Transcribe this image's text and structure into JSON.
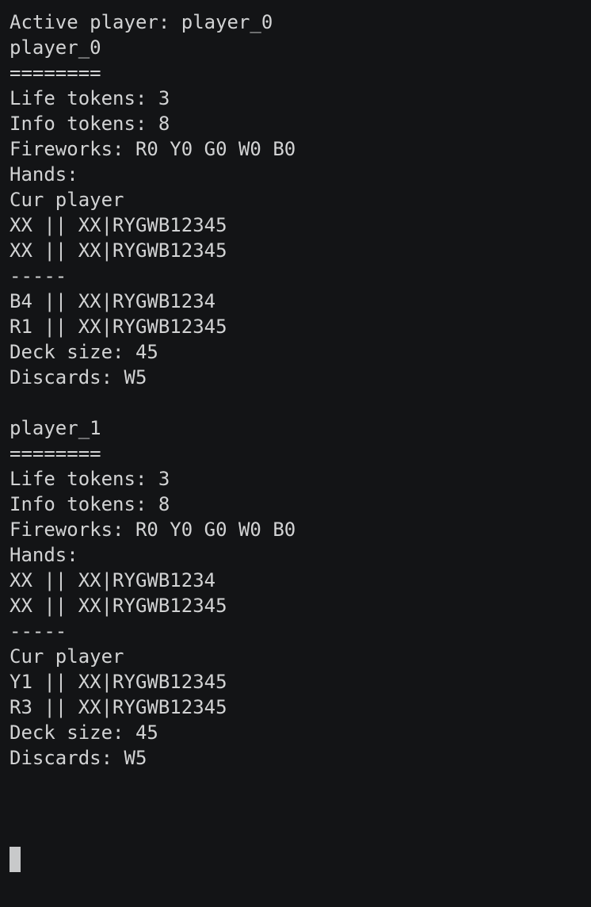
{
  "terminal": {
    "lines": [
      "Active player: player_0",
      "player_0",
      "========",
      "Life tokens: 3",
      "Info tokens: 8",
      "Fireworks: R0 Y0 G0 W0 B0",
      "Hands:",
      "Cur player",
      "XX || XX|RYGWB12345",
      "XX || XX|RYGWB12345",
      "-----",
      "B4 || XX|RYGWB1234",
      "R1 || XX|RYGWB12345",
      "Deck size: 45",
      "Discards: W5",
      "",
      "player_1",
      "========",
      "Life tokens: 3",
      "Info tokens: 8",
      "Fireworks: R0 Y0 G0 W0 B0",
      "Hands:",
      "XX || XX|RYGWB1234",
      "XX || XX|RYGWB12345",
      "-----",
      "Cur player",
      "Y1 || XX|RYGWB12345",
      "R3 || XX|RYGWB12345",
      "Deck size: 45",
      "Discards: W5"
    ]
  },
  "colors": {
    "background": "#131416",
    "text": "#d2d3d4",
    "cursor": "#c8c9ca"
  }
}
